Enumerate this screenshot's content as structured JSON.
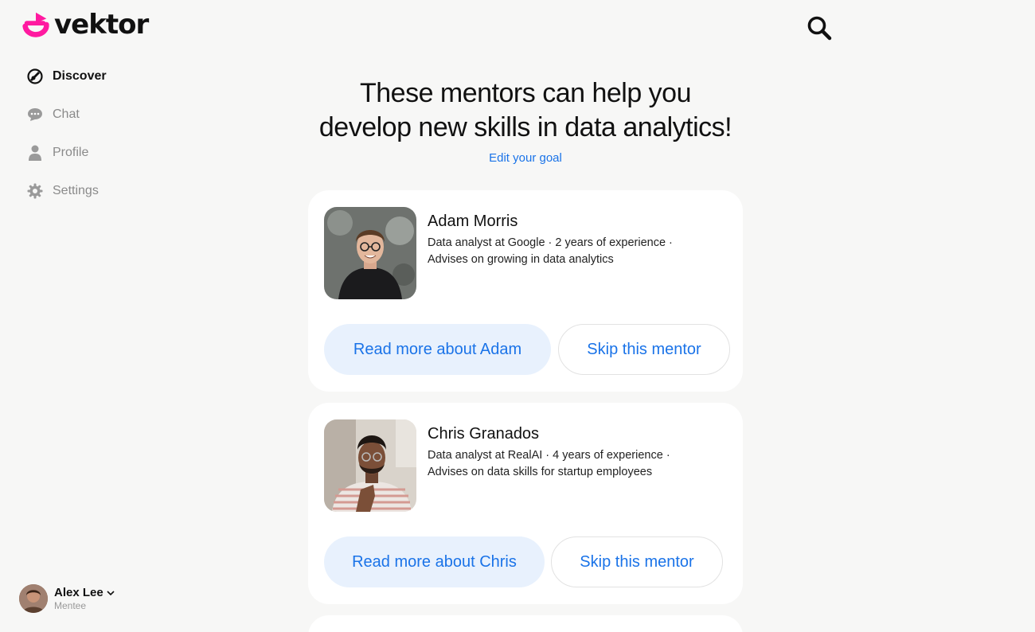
{
  "brand": {
    "name": "vektor",
    "accent": "#ff1aa0"
  },
  "nav": {
    "items": [
      {
        "label": "Discover",
        "icon": "discover-icon",
        "active": true
      },
      {
        "label": "Chat",
        "icon": "chat-icon",
        "active": false
      },
      {
        "label": "Profile",
        "icon": "profile-icon",
        "active": false
      },
      {
        "label": "Settings",
        "icon": "gear-icon",
        "active": false
      }
    ]
  },
  "user": {
    "name": "Alex Lee",
    "role": "Mentee"
  },
  "search": {
    "icon": "search-icon"
  },
  "main": {
    "headline_line1": "These mentors can help you",
    "headline_line2": "develop new skills in data analytics!",
    "edit_goal": "Edit your goal"
  },
  "mentors": [
    {
      "name": "Adam Morris",
      "desc_line1": "Data analyst at Google  · 2 years of experience ·",
      "desc_line2": "Advises on growing in data analytics",
      "read_more": "Read more about Adam",
      "skip": "Skip this mentor"
    },
    {
      "name": "Chris Granados",
      "desc_line1": "Data analyst at RealAI · 4 years of experience ·",
      "desc_line2": "Advises on data skills for startup employees",
      "read_more": "Read more about Chris",
      "skip": "Skip this mentor"
    }
  ],
  "colors": {
    "link": "#1a73e8",
    "primary_button_bg": "#e8f1fd",
    "background": "#f7f7f6"
  }
}
